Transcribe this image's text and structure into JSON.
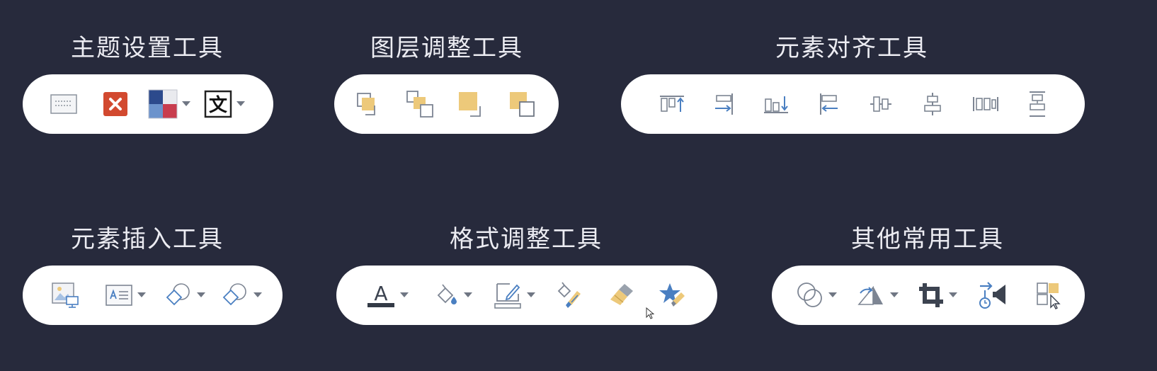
{
  "groups": [
    {
      "id": "theme",
      "title": "主题设置工具"
    },
    {
      "id": "layer",
      "title": "图层调整工具"
    },
    {
      "id": "align",
      "title": "元素对齐工具"
    },
    {
      "id": "insert",
      "title": "元素插入工具"
    },
    {
      "id": "format",
      "title": "格式调整工具"
    },
    {
      "id": "other",
      "title": "其他常用工具"
    }
  ],
  "theme_tools": {
    "font_icon_text": "文",
    "items": [
      "slide-layout-icon",
      "delete-theme-icon",
      "theme-colors-icon",
      "theme-fonts-icon"
    ]
  },
  "layer_tools": {
    "items": [
      "bring-forward-icon",
      "send-backward-icon",
      "bring-to-front-icon",
      "send-to-back-icon"
    ]
  },
  "align_tools": {
    "items": [
      "align-top-icon",
      "align-right-icon",
      "align-bottom-icon",
      "align-left-icon",
      "align-middle-icon",
      "align-center-icon",
      "distribute-horizontal-icon",
      "distribute-vertical-icon"
    ]
  },
  "insert_tools": {
    "items": [
      "insert-picture-icon",
      "insert-textbox-icon",
      "insert-shape-icon",
      "insert-shape-alt-icon"
    ]
  },
  "format_tools": {
    "font_color_letter": "A",
    "items": [
      "font-color-icon",
      "fill-color-icon",
      "outline-color-icon",
      "format-painter-icon",
      "brush-icon",
      "animation-painter-icon"
    ]
  },
  "other_tools": {
    "items": [
      "merge-shapes-icon",
      "send-to-back-shape-icon",
      "crop-icon",
      "animation-icon",
      "selection-pane-icon"
    ]
  },
  "colors": {
    "background": "#272a3c",
    "pill": "#ffffff",
    "icon_gray": "#7d8593",
    "icon_blue": "#4a7fc1",
    "icon_tan": "#edc97a",
    "delete_red": "#d2492f"
  }
}
